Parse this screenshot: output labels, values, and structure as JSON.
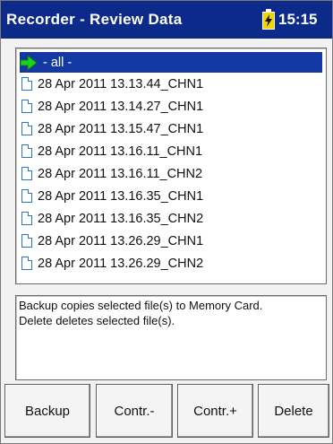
{
  "header": {
    "title": "Recorder - Review Data",
    "time": "15:15",
    "battery_icon": "battery-charging-icon",
    "colors": {
      "titlebar": "#0c2a8a",
      "battery": "#f2d400"
    }
  },
  "file_list": {
    "selected_index": 0,
    "items": [
      {
        "label": "- all -",
        "icon": "green-arrow-icon"
      },
      {
        "label": "28 Apr 2011 13.13.44_CHN1",
        "icon": "file-icon"
      },
      {
        "label": "28 Apr 2011 13.14.27_CHN1",
        "icon": "file-icon"
      },
      {
        "label": "28 Apr 2011 13.15.47_CHN1",
        "icon": "file-icon"
      },
      {
        "label": "28 Apr 2011 13.16.11_CHN1",
        "icon": "file-icon"
      },
      {
        "label": "28 Apr 2011 13.16.11_CHN2",
        "icon": "file-icon"
      },
      {
        "label": "28 Apr 2011 13.16.35_CHN1",
        "icon": "file-icon"
      },
      {
        "label": "28 Apr 2011 13.16.35_CHN2",
        "icon": "file-icon"
      },
      {
        "label": "28 Apr 2011 13.26.29_CHN1",
        "icon": "file-icon"
      },
      {
        "label": "28 Apr 2011 13.26.29_CHN2",
        "icon": "file-icon"
      }
    ]
  },
  "info": {
    "lines": [
      "Backup copies selected file(s) to Memory Card.",
      "Delete deletes selected file(s)."
    ]
  },
  "buttons": {
    "backup": "Backup",
    "contr_minus": "Contr.-",
    "contr_plus": "Contr.+",
    "delete": "Delete"
  }
}
